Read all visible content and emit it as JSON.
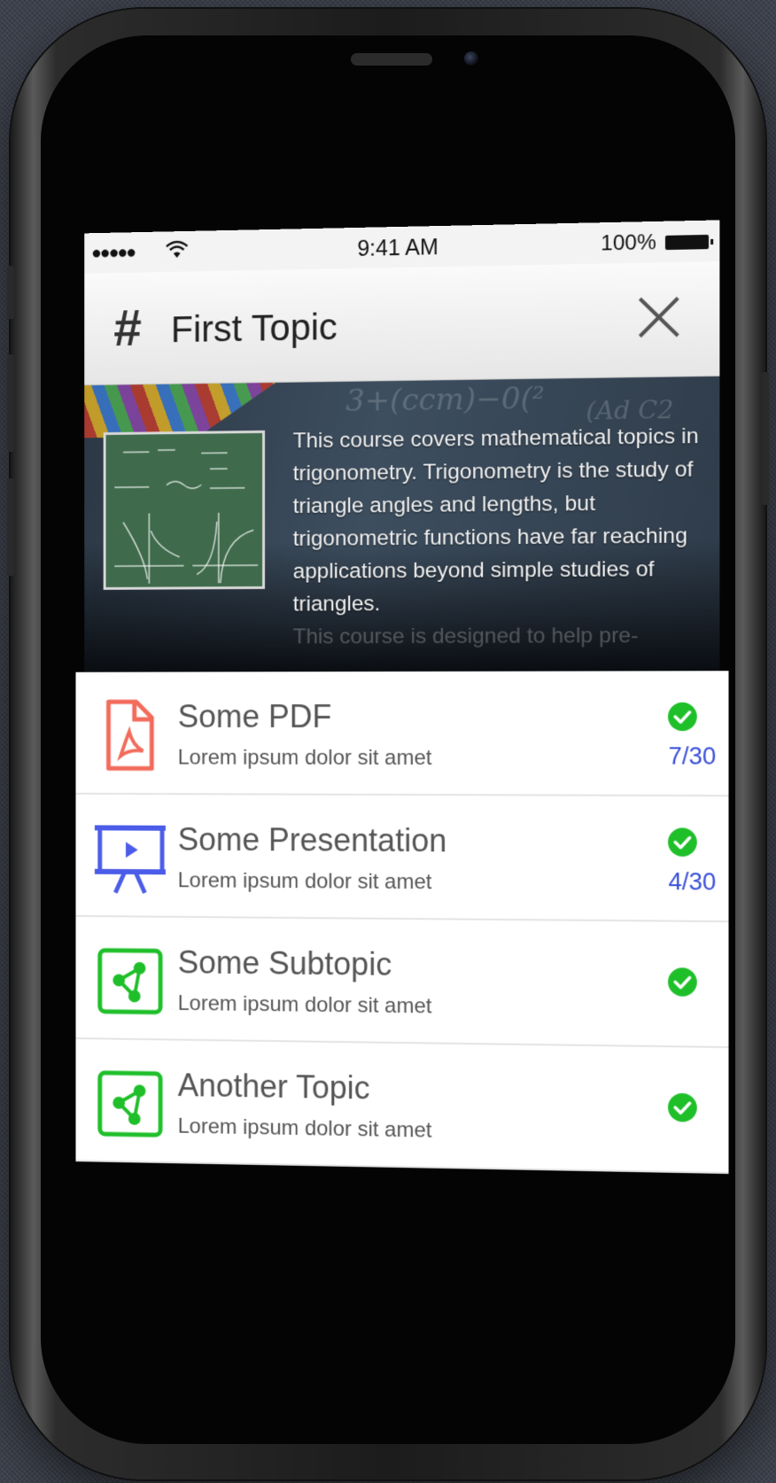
{
  "status_bar": {
    "signal": "●●●●●",
    "time": "9:41 AM",
    "battery": "100%"
  },
  "nav": {
    "title": "First Topic"
  },
  "hero": {
    "description": "This course covers mathematical topics in trigonometry. Trigonometry is the study of triangle angles and lengths, but trigonometric functions have far reaching applications beyond simple studies of triangles.",
    "faded_line": "This course is designed to help pre-"
  },
  "items": [
    {
      "title": "Some PDF",
      "subtitle": "Lorem ipsum dolor sit amet",
      "count": "7/30",
      "icon": "pdf-icon",
      "color": "#f26b5b"
    },
    {
      "title": "Some Presentation",
      "subtitle": "Lorem ipsum dolor sit amet",
      "count": "4/30",
      "icon": "presentation-icon",
      "color": "#4a5ce8"
    },
    {
      "title": "Some Subtopic",
      "subtitle": "Lorem ipsum dolor sit amet",
      "icon": "subtopic-icon",
      "color": "#1fbf2a"
    },
    {
      "title": "Another Topic",
      "subtitle": "Lorem ipsum dolor sit amet",
      "icon": "subtopic-icon",
      "color": "#1fbf2a"
    }
  ],
  "colors": {
    "check": "#1fbf2a",
    "count": "#3a4fd8"
  }
}
